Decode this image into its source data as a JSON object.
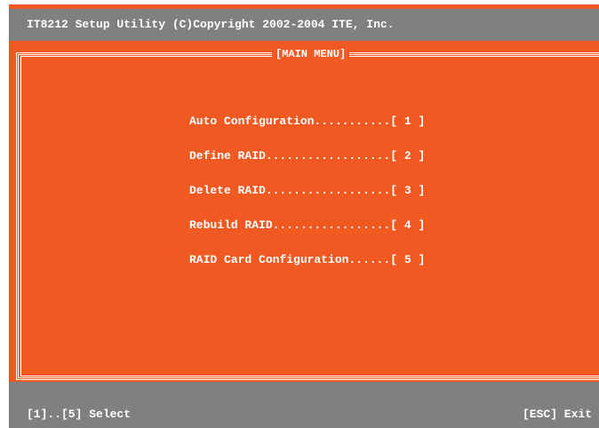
{
  "title_bar": {
    "text": "IT8212 Setup Utility (C)Copyright 2002-2004 ITE, Inc."
  },
  "menu": {
    "title": "[MAIN MENU]",
    "items": [
      {
        "label": "Auto Configuration...........[ 1 ]"
      },
      {
        "label": "Define RAID..................[ 2 ]"
      },
      {
        "label": "Delete RAID..................[ 3 ]"
      },
      {
        "label": "Rebuild RAID.................[ 4 ]"
      },
      {
        "label": "RAID Card Configuration......[ 5 ]"
      }
    ]
  },
  "status_bar": {
    "left": "[1]..[5] Select",
    "right": "[ESC] Exit"
  },
  "colors": {
    "background": "#f05a22",
    "bars": "#808080",
    "text": "#ffffff"
  }
}
